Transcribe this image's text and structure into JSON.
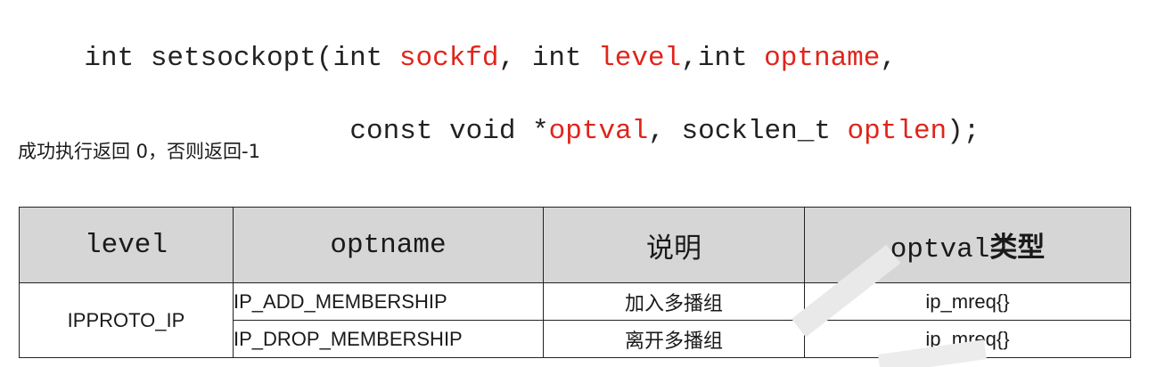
{
  "signature": {
    "line1": [
      {
        "text": "int setsockopt(int ",
        "kind": "plain"
      },
      {
        "text": "sockfd",
        "kind": "param"
      },
      {
        "text": ", int ",
        "kind": "plain"
      },
      {
        "text": "level",
        "kind": "param"
      },
      {
        "text": ",int ",
        "kind": "plain"
      },
      {
        "text": "optname",
        "kind": "param"
      },
      {
        "text": ",",
        "kind": "plain"
      }
    ],
    "line2": [
      {
        "text": "const void *",
        "kind": "plain"
      },
      {
        "text": "optval",
        "kind": "param"
      },
      {
        "text": ", socklen_t ",
        "kind": "plain"
      },
      {
        "text": "optlen",
        "kind": "param"
      },
      {
        "text": ");",
        "kind": "plain"
      }
    ]
  },
  "return_note": "成功执行返回 0，否则返回-1",
  "table": {
    "headers": {
      "level": "level",
      "optname": "optname",
      "desc": "说明",
      "optval_prefix": "optval",
      "optval_suffix": "类型"
    },
    "level_value": "IPPROTO_IP",
    "rows": [
      {
        "optname": "IP_ADD_MEMBERSHIP",
        "desc": "加入多播组",
        "optval": "ip_mreq{}"
      },
      {
        "optname": "IP_DROP_MEMBERSHIP",
        "desc": "离开多播组",
        "optval": "ip_mreq{}"
      }
    ]
  },
  "colors": {
    "param": "#e0251b",
    "text": "#222222",
    "header_bg": "#d6d6d6"
  }
}
